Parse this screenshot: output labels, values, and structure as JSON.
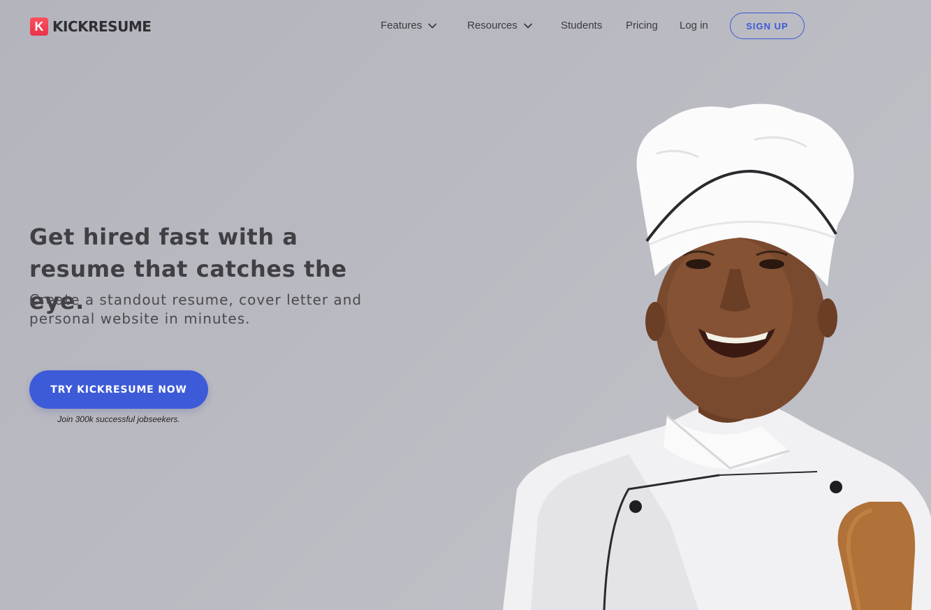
{
  "brand": {
    "name": "KICKRESUME",
    "mark": "K",
    "color": "#ff4f5e"
  },
  "nav": {
    "items": [
      {
        "label": "Features",
        "has_dropdown": true
      },
      {
        "label": "Resources",
        "has_dropdown": true
      },
      {
        "label": "Students",
        "has_dropdown": false
      },
      {
        "label": "Pricing",
        "has_dropdown": false
      },
      {
        "label": "Log in",
        "has_dropdown": false
      }
    ],
    "signup_label": "SIGN UP"
  },
  "hero": {
    "headline": "Get hired fast with a resume that catches the eye.",
    "subheadline": "Create a standout resume, cover letter and personal website in minutes.",
    "cta_label": "TRY KICKRESUME NOW",
    "cta_note": "Join 300k successful jobseekers."
  },
  "colors": {
    "accent": "#3d5ad8",
    "background": "#b9b9c1",
    "text_dark": "#404044"
  },
  "icons": {
    "dropdown": "chevron-down-icon"
  }
}
